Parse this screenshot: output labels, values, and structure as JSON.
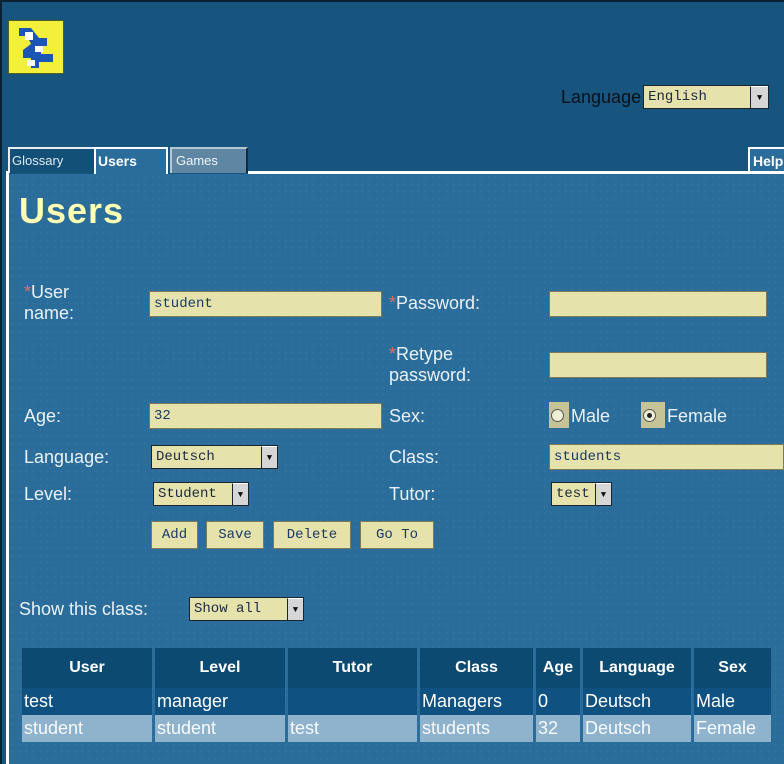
{
  "header": {
    "logo_name": "running-man-logo",
    "language_label": "Language",
    "language_value": "English"
  },
  "tabs": [
    {
      "label": "Glossary"
    },
    {
      "label": "Users"
    },
    {
      "label": "Games"
    },
    {
      "label": "Help"
    }
  ],
  "page": {
    "title": "Users"
  },
  "form": {
    "required_mark": "*",
    "username_label_line1": "User",
    "username_label_line2": "name:",
    "username_value": "student",
    "password_label": "Password:",
    "password_value": "",
    "retype_label_line1": "Retype",
    "retype_label_line2": "password:",
    "retype_value": "",
    "age_label": "Age:",
    "age_value": "32",
    "sex_label": "Sex:",
    "sex_options": [
      "Male",
      "Female"
    ],
    "sex_selected": "Female",
    "language_label": "Language:",
    "language_value": "Deutsch",
    "class_label": "Class:",
    "class_value": "students",
    "level_label": "Level:",
    "level_value": "Student",
    "tutor_label": "Tutor:",
    "tutor_value": "test",
    "buttons": {
      "add": "Add",
      "save": "Save",
      "delete": "Delete",
      "goto": "Go To"
    }
  },
  "filter": {
    "label": "Show this class:",
    "value": "Show all"
  },
  "table": {
    "headers": [
      "User",
      "Level",
      "Tutor",
      "Class",
      "Age",
      "Language",
      "Sex"
    ],
    "rows": [
      [
        "test",
        "manager",
        "",
        "Managers",
        "0",
        "Deutsch",
        "Male"
      ],
      [
        "student",
        "student",
        "test",
        "students",
        "32",
        "Deutsch",
        "Female"
      ]
    ]
  },
  "colors": {
    "background": "#17547e",
    "content": "#2a6d9a",
    "field": "#e6e2ac",
    "title": "#ffffb4",
    "header_cell": "#0d4a72",
    "selected_row": "#8fb3cc"
  }
}
